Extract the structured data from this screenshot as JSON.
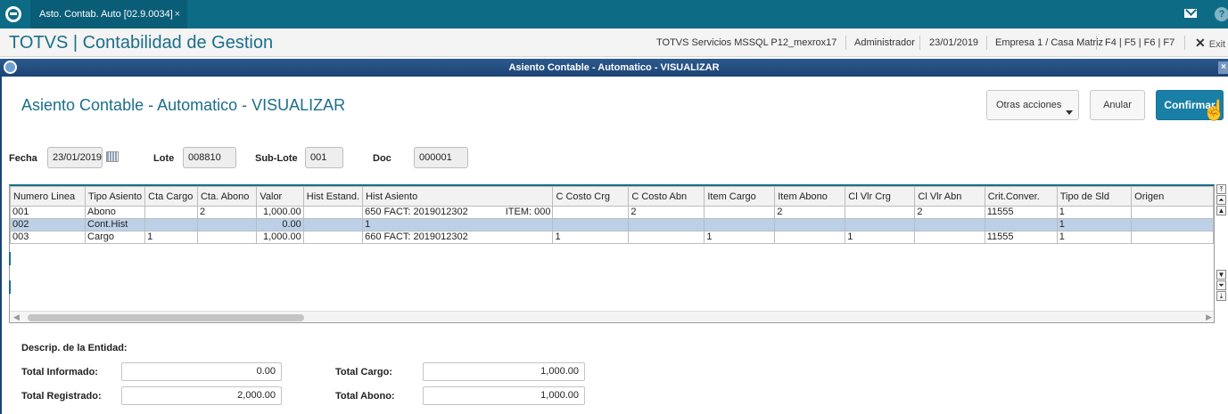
{
  "browser": {
    "tab_label": "Asto. Contab. Auto [02.9.0034]",
    "tab_close": "×",
    "help_label": "?"
  },
  "app": {
    "title": "TOTVS | Contabilidad de Gestion",
    "server": "TOTVS Servicios MSSQL P12_mexrox17",
    "user": "Administrador",
    "date": "23/01/2019",
    "company": "Empresa 1 / Casa Matriz",
    "shortcuts": "F4 | F5 | F6 | F7",
    "exit_label": "Exit",
    "exit_icon": "✕"
  },
  "dialog": {
    "bar_title": "Asiento Contable - Automatico - VISUALIZAR",
    "heading": "Asiento Contable - Automatico - VISUALIZAR",
    "close_label": "×",
    "buttons": {
      "otras": "Otras acciones",
      "anular": "Anular",
      "confirmar": "Confirmar"
    }
  },
  "form": {
    "fecha_label": "Fecha",
    "fecha_value": "23/01/2019",
    "lote_label": "Lote",
    "lote_value": "008810",
    "sublote_label": "Sub-Lote",
    "sublote_value": "001",
    "doc_label": "Doc",
    "doc_value": "000001"
  },
  "grid": {
    "columns": [
      "Numero Linea",
      "Tipo Asiento",
      "Cta Cargo",
      "Cta. Abono",
      "Valor",
      "Hist Estand.",
      "Hist Asiento",
      "C Costo Crg",
      "C Costo Abn",
      "Item Cargo",
      "Item Abono",
      "Cl Vlr Crg",
      "Cl Vlr Abn",
      "Crit.Conver.",
      "Tipo de Sld",
      "Origen"
    ],
    "rows": [
      [
        "001",
        "Abono",
        "",
        "2",
        "1,000.00",
        "",
        "650 FACT: 2019012302",
        "",
        "2",
        "",
        "2",
        "",
        "2",
        "11555",
        "1",
        ""
      ],
      [
        "002",
        "Cont.Hist",
        "",
        "",
        "0.00",
        "",
        "1",
        "",
        "",
        "",
        "",
        "",
        "",
        "",
        "1",
        ""
      ],
      [
        "003",
        "Cargo",
        "1",
        "",
        "1,000.00",
        "",
        "660 FACT: 2019012302",
        "1",
        "",
        "1",
        "",
        "1",
        "",
        "11555",
        "1",
        ""
      ]
    ],
    "row1_item_note": "ITEM: 000",
    "selected_row": 1
  },
  "totals": {
    "descrip_label": "Descrip. de la Entidad:",
    "informado_label": "Total Informado:",
    "informado_value": "0.00",
    "registrado_label": "Total Registrado:",
    "registrado_value": "2,000.00",
    "cargo_label": "Total Cargo:",
    "cargo_value": "1,000.00",
    "abono_label": "Total Abono:",
    "abono_value": "1,000.00"
  },
  "colors": {
    "topbar": "#0d6b86",
    "accent": "#1a6e8c",
    "dialog_bar": "#1c4474",
    "selected_row": "#bcd1e8",
    "primary_button": "#1a7fa6"
  }
}
